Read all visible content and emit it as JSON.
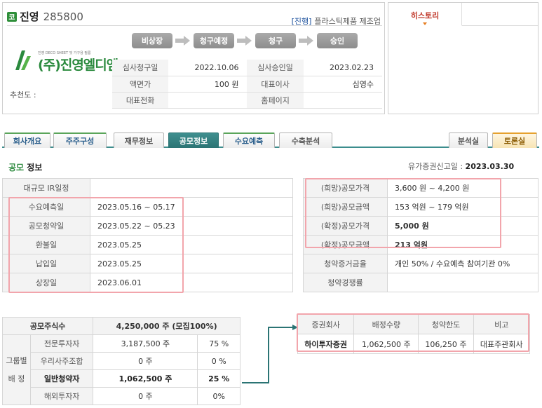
{
  "header": {
    "badge": "코",
    "company": "진영",
    "code": "285800",
    "industry_tag": "[진행]",
    "industry": "플라스틱제품 제조업",
    "logo_tagline": "진영 DECO SHEET 및 가구용 필름",
    "logo_text": "(주)진영엘디엠",
    "recommend_label": "추천도 :"
  },
  "steps": [
    "비상장",
    "청구예정",
    "청구",
    "승인"
  ],
  "info": {
    "rows": [
      {
        "l1": "심사청구일",
        "v1": "2022.10.06",
        "l2": "심사승인일",
        "v2": "2023.02.23"
      },
      {
        "l1": "액면가",
        "v1": "100 원",
        "l2": "대표이사",
        "v2": "심영수"
      },
      {
        "l1": "대표전화",
        "v1": "",
        "l2": "홈페이지",
        "v2": ""
      }
    ]
  },
  "history": {
    "tab": "히스토리"
  },
  "tabs": {
    "company": "회사개요",
    "shareholders": "주주구성",
    "finance": "재무정보",
    "ipo": "공모정보",
    "demand": "수요예측",
    "return": "수측분석",
    "analysis": "분석실",
    "forum": "토론실"
  },
  "section": {
    "title_hl": "공모",
    "title_rest": " 정보",
    "filing_label": "유가증권신고일 : ",
    "filing_date": "2023.03.30"
  },
  "schedule": [
    {
      "label": "대규모 IR일정",
      "value": ""
    },
    {
      "label": "수요예측일",
      "value": "2023.05.16 ~ 05.17"
    },
    {
      "label": "공모청약일",
      "value": "2023.05.22 ~ 05.23"
    },
    {
      "label": "환불일",
      "value": "2023.05.25"
    },
    {
      "label": "납입일",
      "value": "2023.05.25"
    },
    {
      "label": "상장일",
      "value": "2023.06.01"
    }
  ],
  "pricing": [
    {
      "label": "(희망)공모가격",
      "value": "3,600 원 ~ 4,200 원"
    },
    {
      "label": "(희망)공모금액",
      "value": "153 억원  ~ 179 억원"
    },
    {
      "label": "(확정)공모가격",
      "value": "5,000 원"
    },
    {
      "label": "(확정)공모금액",
      "value": "213 억원"
    },
    {
      "label": "청약증거금율",
      "value": "개인 50% / 수요예측 참여기관 0%"
    },
    {
      "label": "청약경쟁률",
      "value": ""
    }
  ],
  "allocation": {
    "total_label": "공모주식수",
    "total_value": "4,250,000 주 (모집100%)",
    "side_label_1": "그룹별",
    "side_label_2": "배  정",
    "rows": [
      {
        "label": "전문투자자",
        "shares": "3,187,500 주",
        "pct": "75 %"
      },
      {
        "label": "우리사주조합",
        "shares": "0 주",
        "pct": "0 %"
      },
      {
        "label": "일반청약자",
        "shares": "1,062,500 주",
        "pct": "25 %"
      },
      {
        "label": "해외투자자",
        "shares": "0 주",
        "pct": "0%"
      }
    ]
  },
  "underwriter": {
    "headers": [
      "증권회사",
      "배정수량",
      "청약한도",
      "비고"
    ],
    "row": {
      "name": "하이투자증권",
      "qty": "1,062,500 주",
      "limit": "106,250 주",
      "note": "대표주관회사"
    }
  },
  "colors": {
    "accent": "#2b7474",
    "highlight": "#f2a5ac",
    "red": "#c0392b",
    "brand": "#2b8a3e"
  }
}
